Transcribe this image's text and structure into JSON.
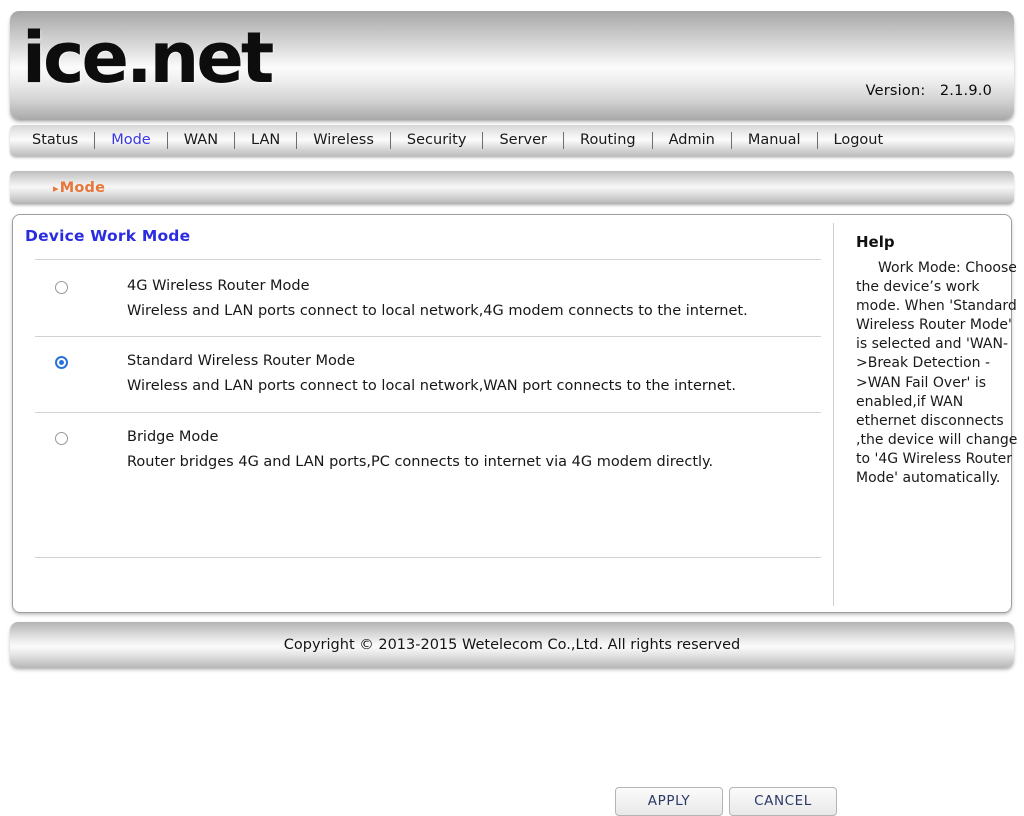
{
  "header": {
    "logo_text": "ice.net",
    "version_label": "Version:",
    "version_value": "2.1.9.0"
  },
  "nav": {
    "items": [
      {
        "label": "Status",
        "active": false
      },
      {
        "label": "Mode",
        "active": true
      },
      {
        "label": "WAN",
        "active": false
      },
      {
        "label": "LAN",
        "active": false
      },
      {
        "label": "Wireless",
        "active": false
      },
      {
        "label": "Security",
        "active": false
      },
      {
        "label": "Server",
        "active": false
      },
      {
        "label": "Routing",
        "active": false
      },
      {
        "label": "Admin",
        "active": false
      },
      {
        "label": "Manual",
        "active": false
      },
      {
        "label": "Logout",
        "active": false
      }
    ]
  },
  "breadcrumb": {
    "arrow": "▸",
    "label": "Mode"
  },
  "main": {
    "title": "Device Work Mode",
    "options": [
      {
        "label": "4G Wireless Router Mode",
        "description": "Wireless and LAN ports connect to local network,4G modem connects to the internet.",
        "selected": false
      },
      {
        "label": "Standard Wireless Router Mode",
        "description": "Wireless and LAN ports connect to local network,WAN port connects to the internet.",
        "selected": true
      },
      {
        "label": "Bridge Mode",
        "description": "Router bridges 4G and LAN ports,PC connects to internet via 4G modem directly.",
        "selected": false
      }
    ],
    "apply_label": "APPLY",
    "cancel_label": "CANCEL"
  },
  "help": {
    "title": "Help",
    "body": "Work Mode: Choose the device’s work mode. When 'Standard Wireless Router Mode' is selected and 'WAN->Break Detection ->WAN Fail Over' is enabled,if WAN ethernet disconnects ,the device will change to '4G Wireless Router Mode' automatically."
  },
  "footer": {
    "copyright": "Copyright © 2013-2015 Wetelecom Co.,Ltd. All rights reserved"
  },
  "colors": {
    "accent_blue": "#2b2ce0",
    "nav_active": "#3b38e0",
    "breadcrumb_orange": "#e8763a",
    "radio_selected": "#2a72d8",
    "button_text": "#2b3a66"
  }
}
